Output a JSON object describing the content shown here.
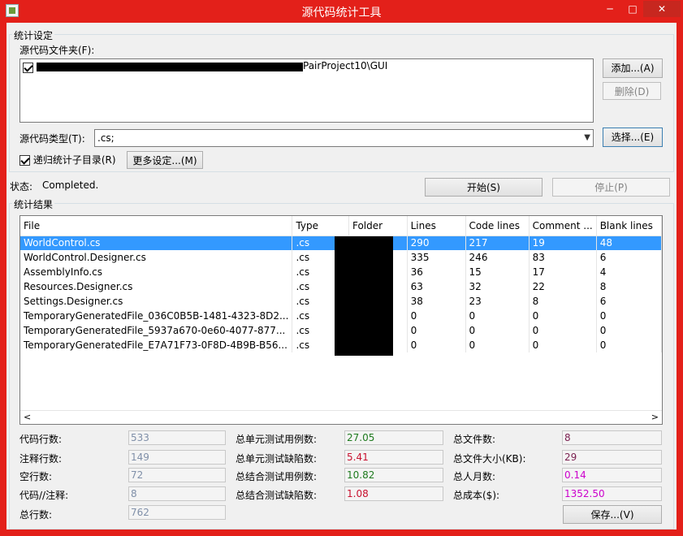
{
  "window": {
    "title": "源代码统计工具",
    "minimize": "─",
    "maximize": "□",
    "close": "✕"
  },
  "settings": {
    "group_label": "统计设定",
    "folder_label": "源代码文件夹(F):",
    "folder_path_visible": "PairProject10\\GUI",
    "add_button": "添加...(A)",
    "delete_button": "删除(D)",
    "type_label": "源代码类型(T):",
    "type_value": ".cs;",
    "choose_button": "选择...(E)",
    "recursive_label": "递归统计子目录(R)",
    "more_settings_button": "更多设定...(M)"
  },
  "status": {
    "label": "状态:",
    "value": "Completed.",
    "start_button": "开始(S)",
    "stop_button": "停止(P)"
  },
  "results": {
    "group_label": "统计结果",
    "columns": [
      "File",
      "Type",
      "Folder",
      "Lines",
      "Code lines",
      "Comment ...",
      "Blank lines"
    ],
    "rows": [
      [
        "WorldControl.cs",
        ".cs",
        "",
        "290",
        "217",
        "19",
        "48"
      ],
      [
        "WorldControl.Designer.cs",
        ".cs",
        "",
        "335",
        "246",
        "83",
        "6"
      ],
      [
        "AssemblyInfo.cs",
        ".cs",
        "",
        "36",
        "15",
        "17",
        "4"
      ],
      [
        "Resources.Designer.cs",
        ".cs",
        "",
        "63",
        "32",
        "22",
        "8"
      ],
      [
        "Settings.Designer.cs",
        ".cs",
        "",
        "38",
        "23",
        "8",
        "6"
      ],
      [
        "TemporaryGeneratedFile_036C0B5B-1481-4323-8D2...",
        ".cs",
        "",
        "0",
        "0",
        "0",
        "0"
      ],
      [
        "TemporaryGeneratedFile_5937a670-0e60-4077-877...",
        ".cs",
        "",
        "0",
        "0",
        "0",
        "0"
      ],
      [
        "TemporaryGeneratedFile_E7A71F73-0F8D-4B9B-B56...",
        ".cs",
        "",
        "0",
        "0",
        "0",
        "0"
      ]
    ],
    "selected_row": 0,
    "scroll_left": "<",
    "scroll_right": ">"
  },
  "summary": {
    "code_lines": {
      "label": "代码行数:",
      "value": "533"
    },
    "comment_lines": {
      "label": "注释行数:",
      "value": "149"
    },
    "blank_lines": {
      "label": "空行数:",
      "value": "72"
    },
    "code_comment_ratio": {
      "label": "代码//注释:",
      "value": "8"
    },
    "total_lines": {
      "label": "总行数:",
      "value": "762"
    },
    "unit_test_cases": {
      "label": "总单元测试用例数:",
      "value": "27.05"
    },
    "unit_test_defects": {
      "label": "总单元测试缺陷数:",
      "value": "5.41"
    },
    "integration_test_cases": {
      "label": "总结合测试用例数:",
      "value": "10.82"
    },
    "integration_test_defects": {
      "label": "总结合测试缺陷数:",
      "value": "1.08"
    },
    "total_files": {
      "label": "总文件数:",
      "value": "8"
    },
    "total_size_kb": {
      "label": "总文件大小(KB):",
      "value": "29"
    },
    "total_person_months": {
      "label": "总人月数:",
      "value": "0.14"
    },
    "total_cost": {
      "label": "总成本($):",
      "value": "1352.50"
    },
    "save_button": "保存...(V)"
  },
  "colors": {
    "titlebar": "#e3201a",
    "selection": "#3399ff",
    "gray_value": "#7f8fa8",
    "green_value": "#1e7a1e",
    "red_value": "#c8102e",
    "purple_value": "#7a1f4f",
    "magenta_value": "#cc00cc"
  }
}
